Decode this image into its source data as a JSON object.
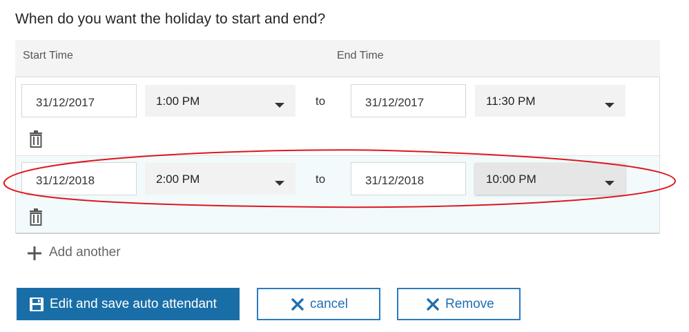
{
  "heading": "When do you want the holiday to start and end?",
  "columns": {
    "start": "Start Time",
    "end": "End Time"
  },
  "rows": [
    {
      "start_date": "31/12/2017",
      "start_time": "1:00 PM",
      "separator": "to",
      "end_date": "31/12/2017",
      "end_time": "11:30 PM"
    },
    {
      "start_date": "31/12/2018",
      "start_time": "2:00 PM",
      "separator": "to",
      "end_date": "31/12/2018",
      "end_time": "10:00 PM"
    }
  ],
  "add_another": "Add another",
  "buttons": {
    "save": "Edit and save auto attendant",
    "cancel": "cancel",
    "remove": "Remove"
  },
  "colors": {
    "primary": "#1a6ea8",
    "accent_outline": "#2a7bbf",
    "highlight_row": "#f2fafc",
    "annotation": "#e0141e"
  },
  "icons": [
    "trash-icon",
    "plus-icon",
    "save-icon",
    "close-icon",
    "chevron-down-icon"
  ]
}
